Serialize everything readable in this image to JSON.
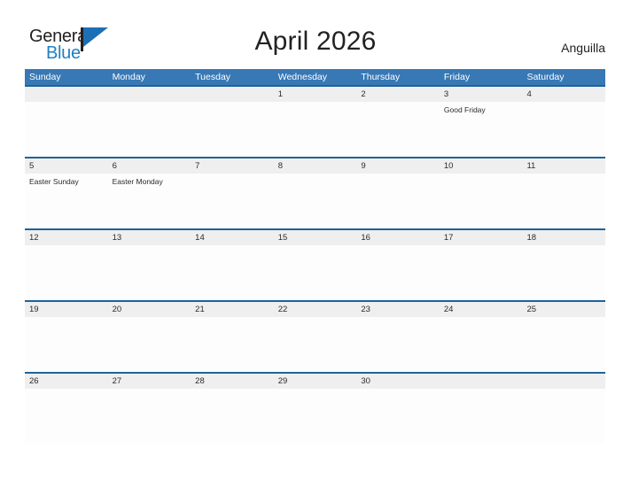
{
  "brand": {
    "name_part1": "General",
    "name_part2": "Blue",
    "flag_icon": "general-blue-flag-logo",
    "accent_color": "#1f7fc4"
  },
  "header": {
    "title": "April 2026",
    "region": "Anguilla"
  },
  "theme": {
    "weekday_header_bg": "#3878b5",
    "weekday_header_text": "#ffffff",
    "row_border": "#1f6399",
    "date_strip_bg": "#efefef",
    "body_bg": "#ffffff",
    "text": "#2b2b2b"
  },
  "calendar": {
    "month": "April",
    "year": "2026",
    "weekdays": [
      "Sunday",
      "Monday",
      "Tuesday",
      "Wednesday",
      "Thursday",
      "Friday",
      "Saturday"
    ],
    "weeks": [
      {
        "days": [
          {
            "number": "",
            "event": ""
          },
          {
            "number": "",
            "event": ""
          },
          {
            "number": "",
            "event": ""
          },
          {
            "number": "1",
            "event": ""
          },
          {
            "number": "2",
            "event": ""
          },
          {
            "number": "3",
            "event": "Good Friday"
          },
          {
            "number": "4",
            "event": ""
          }
        ]
      },
      {
        "days": [
          {
            "number": "5",
            "event": "Easter Sunday"
          },
          {
            "number": "6",
            "event": "Easter Monday"
          },
          {
            "number": "7",
            "event": ""
          },
          {
            "number": "8",
            "event": ""
          },
          {
            "number": "9",
            "event": ""
          },
          {
            "number": "10",
            "event": ""
          },
          {
            "number": "11",
            "event": ""
          }
        ]
      },
      {
        "days": [
          {
            "number": "12",
            "event": ""
          },
          {
            "number": "13",
            "event": ""
          },
          {
            "number": "14",
            "event": ""
          },
          {
            "number": "15",
            "event": ""
          },
          {
            "number": "16",
            "event": ""
          },
          {
            "number": "17",
            "event": ""
          },
          {
            "number": "18",
            "event": ""
          }
        ]
      },
      {
        "days": [
          {
            "number": "19",
            "event": ""
          },
          {
            "number": "20",
            "event": ""
          },
          {
            "number": "21",
            "event": ""
          },
          {
            "number": "22",
            "event": ""
          },
          {
            "number": "23",
            "event": ""
          },
          {
            "number": "24",
            "event": ""
          },
          {
            "number": "25",
            "event": ""
          }
        ]
      },
      {
        "days": [
          {
            "number": "26",
            "event": ""
          },
          {
            "number": "27",
            "event": ""
          },
          {
            "number": "28",
            "event": ""
          },
          {
            "number": "29",
            "event": ""
          },
          {
            "number": "30",
            "event": ""
          },
          {
            "number": "",
            "event": ""
          },
          {
            "number": "",
            "event": ""
          }
        ]
      }
    ]
  }
}
